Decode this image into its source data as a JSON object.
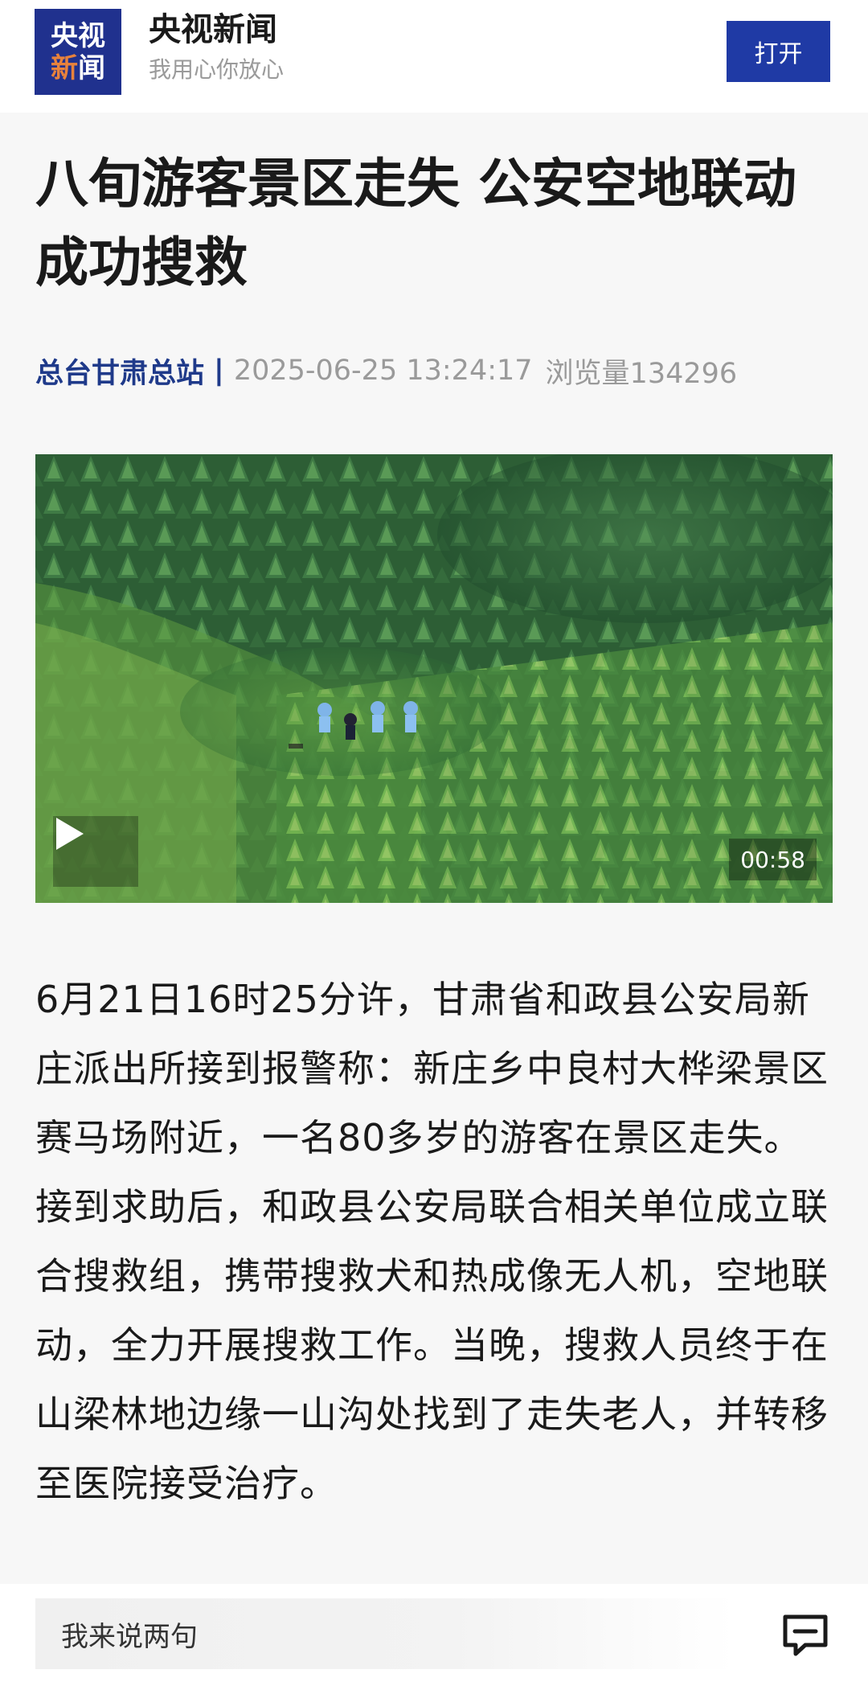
{
  "header": {
    "logo_line1": "央视",
    "logo_line2_a": "新",
    "logo_line2_b": "闻",
    "brand_name": "央视新闻",
    "slogan": "我用心你放心",
    "open_button": "打开"
  },
  "article": {
    "title": "八旬游客景区走失 公安空地联动成功搜救",
    "source": "总台甘肃总站",
    "separator": "|",
    "timestamp": "2025-06-25 13:24:17",
    "views": "浏览量134296",
    "video": {
      "duration": "00:58",
      "icon": "play-icon"
    },
    "body": "6月21日16时25分许，甘肃省和政县公安局新庄派出所接到报警称：新庄乡中良村大桦梁景区赛马场附近，一名80多岁的游客在景区走失。接到求助后，和政县公安局联合相关单位成立联合搜救组，携带搜救犬和热成像无人机，空地联动，全力开展搜救工作。当晚，搜救人员终于在山梁林地边缘一山沟处找到了走失老人，并转移至医院接受治疗。"
  },
  "comment_bar": {
    "placeholder": "我来说两句",
    "icon": "comment-icon"
  },
  "colors": {
    "brand_blue": "#20318e",
    "button_blue": "#1f3aa5",
    "source_blue": "#1f3a8a",
    "logo_accent": "#e8823c",
    "muted_gray": "#9a9a9a"
  }
}
